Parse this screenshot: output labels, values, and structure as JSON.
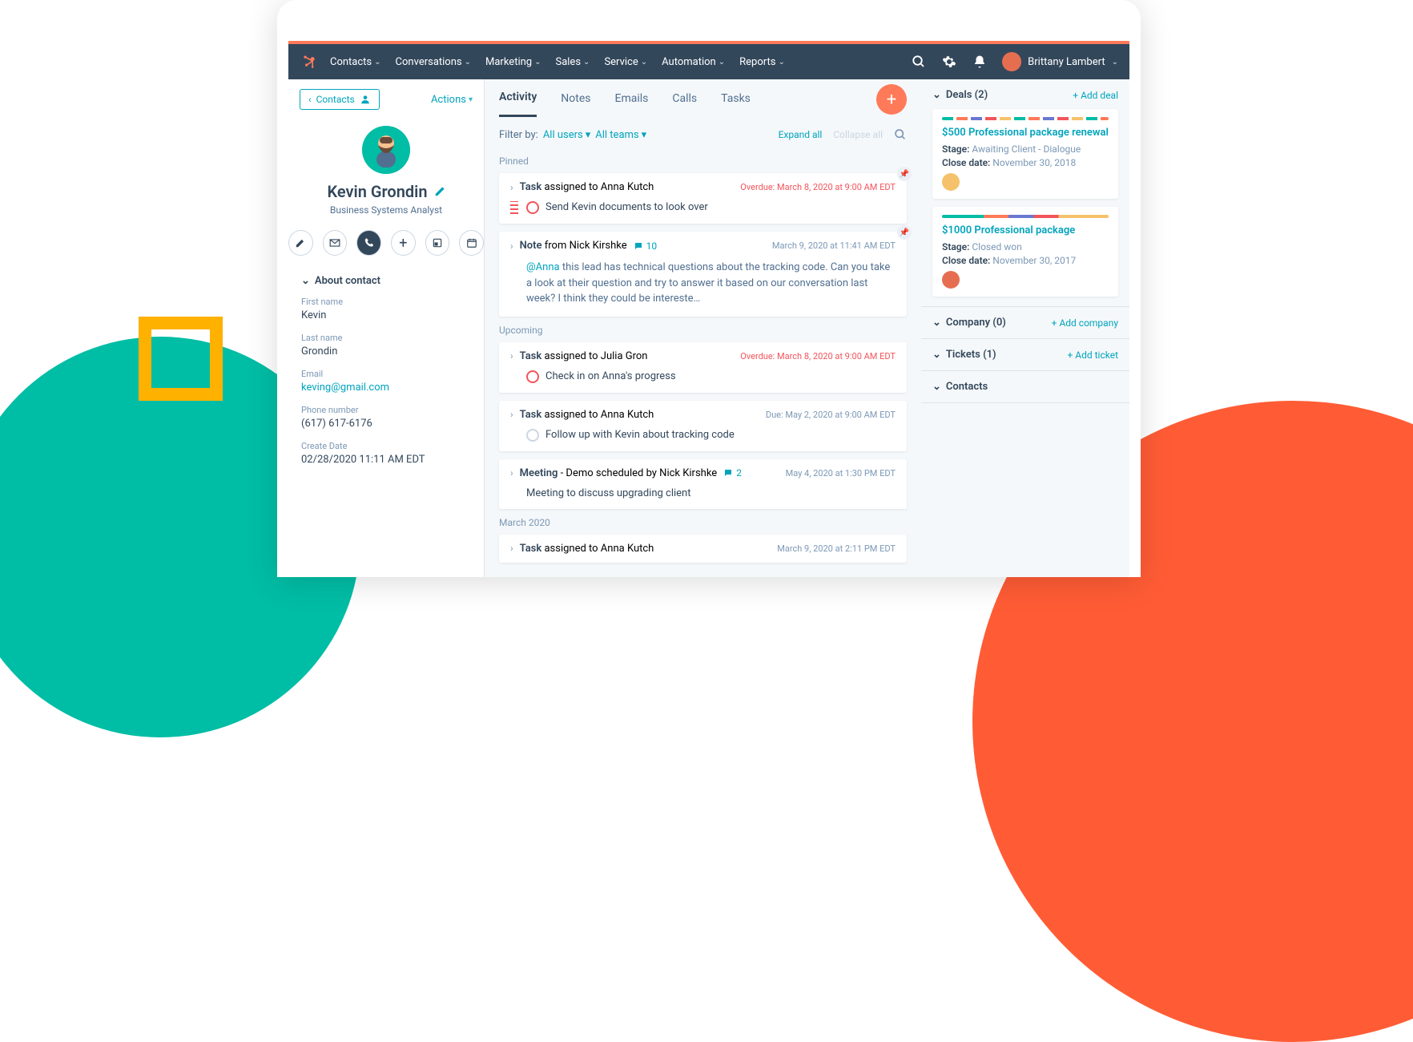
{
  "nav": {
    "items": [
      "Contacts",
      "Conversations",
      "Marketing",
      "Sales",
      "Service",
      "Automation",
      "Reports"
    ],
    "user_name": "Brittany Lambert"
  },
  "sidebar": {
    "back_label": "Contacts",
    "actions_label": "Actions",
    "contact_name": "Kevin Grondin",
    "contact_title": "Business Systems Analyst",
    "about_header": "About contact",
    "fields": [
      {
        "label": "First name",
        "value": "Kevin"
      },
      {
        "label": "Last name",
        "value": "Grondin"
      },
      {
        "label": "Email",
        "value": "keving@gmail.com",
        "link": true
      },
      {
        "label": "Phone number",
        "value": "(617) 617-6176"
      },
      {
        "label": "Create Date",
        "value": "02/28/2020 11:11 AM EDT"
      }
    ]
  },
  "main": {
    "tabs": [
      "Activity",
      "Notes",
      "Emails",
      "Calls",
      "Tasks"
    ],
    "filter_label": "Filter by:",
    "filter_users": "All users",
    "filter_teams": "All teams",
    "expand_label": "Expand all",
    "collapse_label": "Collapse all",
    "sections": {
      "pinned": "Pinned",
      "upcoming": "Upcoming",
      "march": "March 2020"
    },
    "cards": {
      "pinned_task": {
        "type": "Task",
        "assigned_to": " assigned to Anna Kutch",
        "body": "Send Kevin documents to look over",
        "meta": "Overdue: March 8, 2020 at 9:00 AM EDT",
        "overdue": true
      },
      "pinned_note": {
        "type": "Note",
        "from": " from Nick Kirshke",
        "comments": "10",
        "meta": "March 9, 2020 at 11:41 AM EDT",
        "mention": "@Anna",
        "body": " this lead has technical questions about the tracking code. Can you take a look at their question and try to answer it based on our conversation last week? I think they could be intereste…"
      },
      "upcoming1": {
        "type": "Task",
        "assigned_to": " assigned to Julia Gron",
        "body": "Check in on Anna's progress",
        "meta": "Overdue: March 8, 2020 at 9:00 AM EDT",
        "overdue": true
      },
      "upcoming2": {
        "type": "Task",
        "assigned_to": " assigned to Anna Kutch",
        "body": "Follow up with Kevin about tracking code",
        "meta": "Due: May 2, 2020 at 9:00 AM EDT"
      },
      "upcoming3": {
        "type": "Meeting",
        "title_extra": " - Demo",
        " scheduled_by": " scheduled by Nick Kirshke",
        "comments": "2",
        "body": "Meeting to discuss upgrading client",
        "meta": "May 4, 2020 at 1:30 PM EDT"
      },
      "march1": {
        "type": "Task",
        "assigned_to": " assigned to Anna Kutch",
        "meta": "March 9, 2020 at 2:11 PM EDT"
      }
    }
  },
  "right": {
    "deals": {
      "title": "Deals (2)",
      "add": "+ Add deal",
      "items": [
        {
          "title": "$500 Professional package renewal",
          "stage_label": "Stage:",
          "stage": " Awaiting Client - Dialogue",
          "close_label": "Close date:",
          "close": " November 30, 2018"
        },
        {
          "title": "$1000 Professional package",
          "stage_label": "Stage:",
          "stage": " Closed won",
          "close_label": "Close date:",
          "close": " November 30, 2017"
        }
      ]
    },
    "company": {
      "title": "Company (0)",
      "add": "+ Add company"
    },
    "tickets": {
      "title": "Tickets (1)",
      "add": "+ Add ticket"
    },
    "contacts": {
      "title": "Contacts"
    }
  }
}
